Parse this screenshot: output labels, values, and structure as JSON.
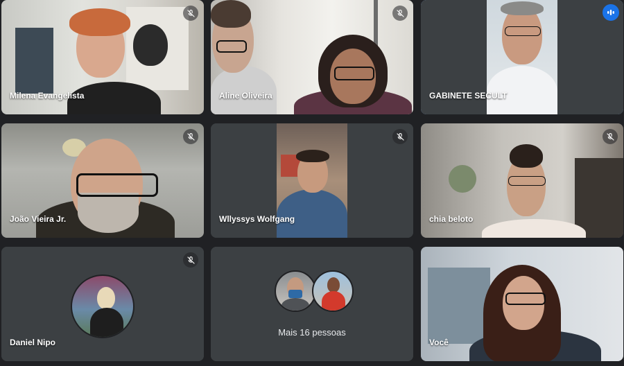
{
  "participants": [
    {
      "name": "Milena Evangelista",
      "muted": true
    },
    {
      "name": "Aline Oliveira",
      "muted": true
    },
    {
      "name": "GABINETE SECULT",
      "muted": false,
      "speaking": true
    },
    {
      "name": "João Vieira Jr.",
      "muted": true
    },
    {
      "name": "Wllyssys Wolfgang",
      "muted": true
    },
    {
      "name": "chia beloto",
      "muted": true
    },
    {
      "name": "Daniel Nipo",
      "muted": true
    },
    {
      "name": "",
      "muted": false
    },
    {
      "name": "Você",
      "muted": false
    }
  ],
  "more": {
    "label": "Mais 16 pessoas",
    "count": 16
  },
  "colors": {
    "background": "#202124",
    "tile": "#3c4043",
    "speaking_outline": "#8ab4f8",
    "speaking_badge": "#1a73e8"
  },
  "icons": {
    "muted": "mic-off-icon",
    "speaking": "audio-level-icon"
  }
}
